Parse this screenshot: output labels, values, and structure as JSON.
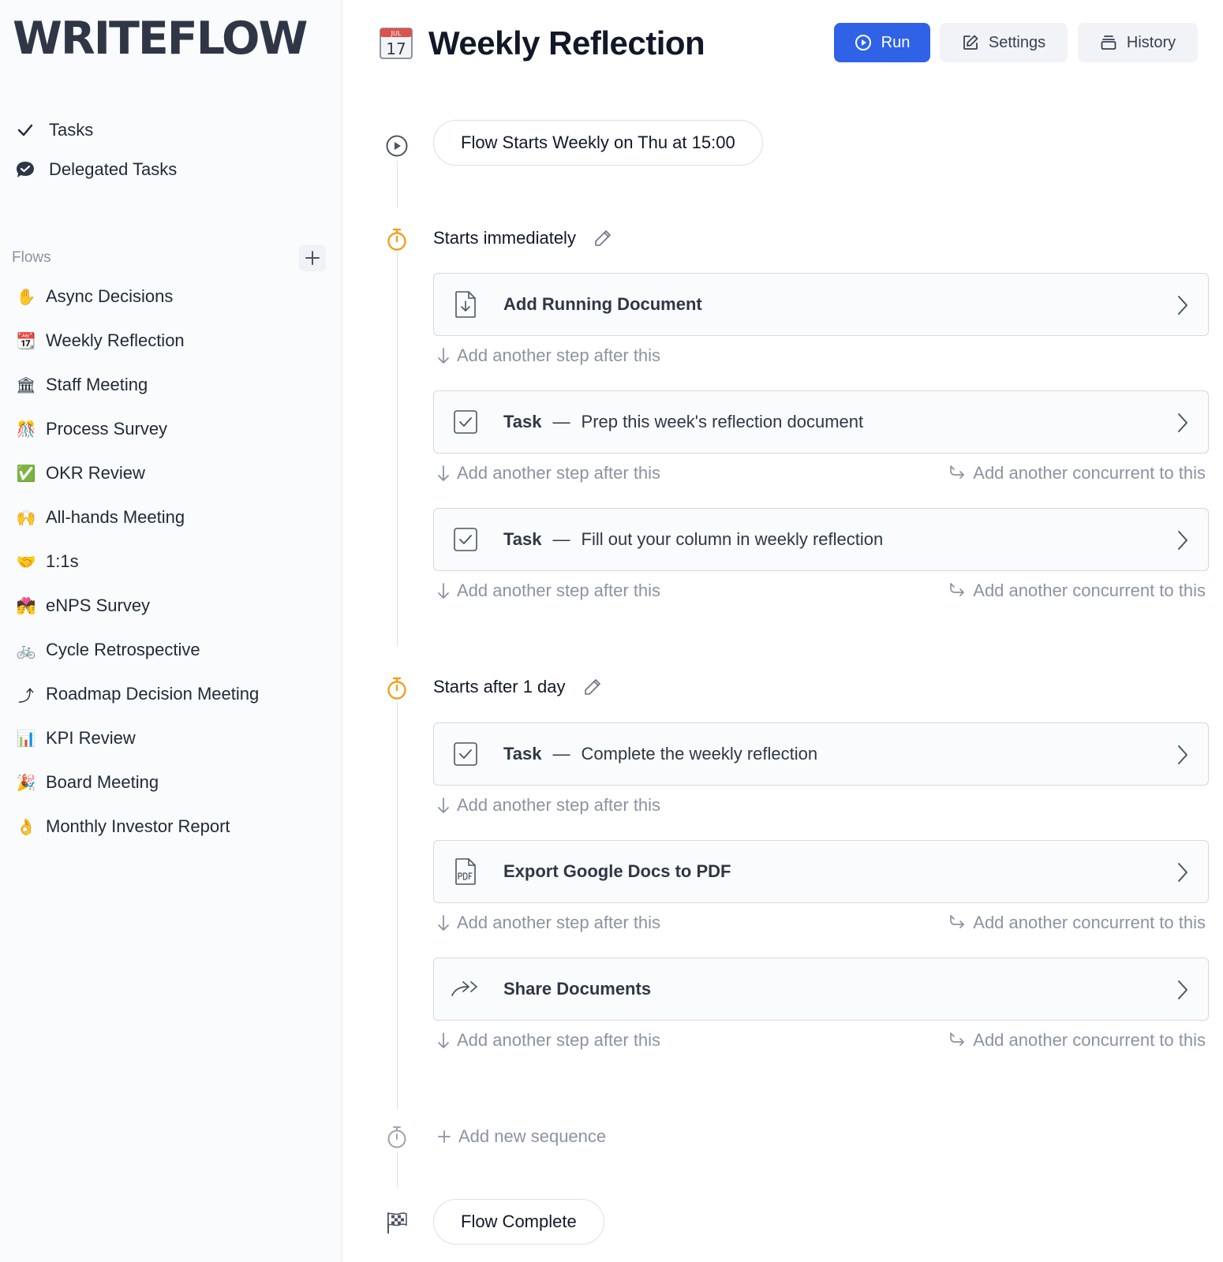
{
  "app": {
    "logo": "WRITEFLOW"
  },
  "sidebar": {
    "nav": [
      {
        "label": "Tasks",
        "icon": "check-icon"
      },
      {
        "label": "Delegated Tasks",
        "icon": "chat-bubble-check-icon"
      }
    ],
    "flows_label": "Flows",
    "flows": [
      {
        "label": "Async Decisions",
        "emoji": "✋"
      },
      {
        "label": "Weekly Reflection",
        "emoji": "📆"
      },
      {
        "label": "Staff Meeting",
        "emoji": "🏛"
      },
      {
        "label": "Process Survey",
        "emoji": "🎊"
      },
      {
        "label": "OKR Review",
        "emoji": "✅"
      },
      {
        "label": "All-hands Meeting",
        "emoji": "🙌"
      },
      {
        "label": "1:1s",
        "emoji": "🤝"
      },
      {
        "label": "eNPS Survey",
        "emoji": "💏"
      },
      {
        "label": "Cycle Retrospective",
        "emoji": "🚲"
      },
      {
        "label": "Roadmap Decision Meeting",
        "emoji": "⤴"
      },
      {
        "label": "KPI Review",
        "emoji": "📊"
      },
      {
        "label": "Board Meeting",
        "emoji": "🎉"
      },
      {
        "label": "Monthly Investor Report",
        "emoji": "👌"
      }
    ]
  },
  "header": {
    "title": "Weekly Reflection",
    "calendar_icon_month": "JUL",
    "calendar_icon_day": "17",
    "run_label": "Run",
    "settings_label": "Settings",
    "history_label": "History"
  },
  "flow": {
    "start_label": "Flow Starts Weekly on Thu at 15:00",
    "add_step_label": "Add another step after this",
    "add_concurrent_label": "Add another concurrent to this",
    "sequences": [
      {
        "title": "Starts immediately",
        "steps": [
          {
            "type": "",
            "label": "Add Running Document",
            "icon": "document-download-icon"
          },
          {
            "type": "Task",
            "label": "Prep this week's reflection document",
            "icon": "checkbox-icon"
          },
          {
            "type": "Task",
            "label": "Fill out your column in weekly reflection",
            "icon": "checkbox-icon"
          }
        ]
      },
      {
        "title": "Starts after 1 day",
        "steps": [
          {
            "type": "Task",
            "label": "Complete the weekly reflection",
            "icon": "checkbox-icon"
          },
          {
            "type": "",
            "label": "Export Google Docs to PDF",
            "icon": "pdf-file-icon"
          },
          {
            "type": "",
            "label": "Share Documents",
            "icon": "share-arrow-icon"
          }
        ]
      }
    ],
    "task_separator": "—",
    "add_sequence_label": "Add new sequence",
    "complete_label": "Flow Complete"
  },
  "colors": {
    "accent": "#2f62e6",
    "timer": "#f0a020",
    "muted_text": "#8b93a1",
    "border": "#d6d9df"
  }
}
